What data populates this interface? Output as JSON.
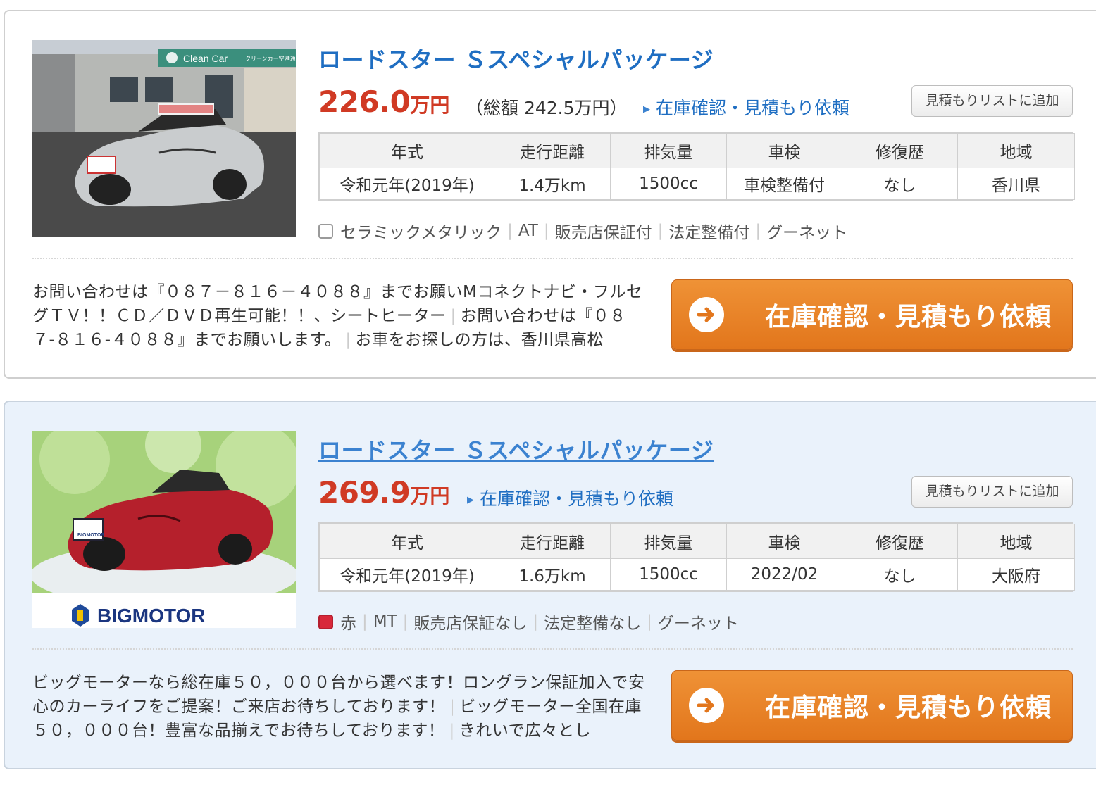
{
  "listings": [
    {
      "title": "ロードスター Ｓスペシャルパッケージ",
      "price_num": "226.0",
      "price_unit": "万円",
      "total_price": "（総額 242.5万円）",
      "inquiry_link": "在庫確認・見積もり依頼",
      "add_list_button": "見積もりリストに追加",
      "spec_headers": [
        "年式",
        "走行距離",
        "排気量",
        "車検",
        "修復歴",
        "地域"
      ],
      "spec_values": [
        "令和元年(2019年)",
        "1.4万km",
        "1500cc",
        "車検整備付",
        "なし",
        "香川県"
      ],
      "color_name": "セラミックメタリック",
      "swatch_color": "#ffffff",
      "tags": [
        "AT",
        "販売店保証付",
        "法定整備付",
        "グーネット"
      ],
      "comments": [
        "お問い合わせは『０８７－８１６－４０８８』までお願いMコネクトナビ・フルセグＴＶ！！ＣＤ／ＤＶＤ再生可能！！、シートヒーター",
        "お問い合わせは『０８７-８１６-４０８８』までお願いします。",
        "お車をお探しの方は、香川県高松"
      ],
      "cta": "在庫確認・見積もり依頼",
      "photo_sign": "Clean Car",
      "photo_sign_sub": "クリーンカー空港通り"
    },
    {
      "title": "ロードスター Ｓスペシャルパッケージ",
      "price_num": "269.9",
      "price_unit": "万円",
      "inquiry_link": "在庫確認・見積もり依頼",
      "add_list_button": "見積もりリストに追加",
      "spec_headers": [
        "年式",
        "走行距離",
        "排気量",
        "車検",
        "修復歴",
        "地域"
      ],
      "spec_values": [
        "令和元年(2019年)",
        "1.6万km",
        "1500cc",
        "2022/02",
        "なし",
        "大阪府"
      ],
      "color_name": "赤",
      "swatch_color": "#d8283a",
      "tags": [
        "MT",
        "販売店保証なし",
        "法定整備なし",
        "グーネット"
      ],
      "comments": [
        "ビッグモーターなら総在庫５０，０００台から選べます！ロングラン保証加入で安心のカーライフをご提案！ご来店お待ちしております！",
        "ビッグモーター全国在庫５０，０００台！豊富な品揃えでお待ちしております！",
        "きれいで広々とし"
      ],
      "cta": "在庫確認・見積もり依頼",
      "photo_logo": "BIGMOTOR",
      "photo_plate": "BIGMOTOR"
    }
  ],
  "colors": {
    "link_blue": "#1f6ec2",
    "price_red": "#d03a24",
    "cta_orange": "#e8811f",
    "alt_bg": "#eaf2fb"
  },
  "icons": {
    "cta_icon": "arrow-right-circle-icon",
    "link_icon": "triangle-right-icon"
  }
}
